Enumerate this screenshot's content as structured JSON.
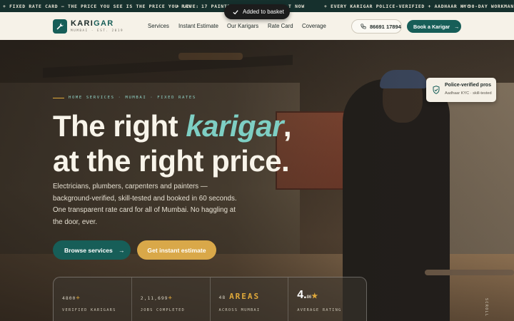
{
  "ticker": [
    "+ FIXED RATE CARD — THE PRICE YOU SEE IS THE PRICE YOU PAY",
    "+ LIVE:",
    "17 PAINTE",
    "T NOW",
    "+ EVERY KARIGAR POLICE-VERIFIED + AADHAAR KYC",
    "+ 90-DAY WORKMANS"
  ],
  "toast": {
    "text": "Added to basket",
    "icon": "check-icon"
  },
  "brand": {
    "name_a": "KARI",
    "name_b": "GAR",
    "tagline": "MUMBAI · EST. 2019",
    "icon": "wrench-icon"
  },
  "nav": {
    "items": [
      "Services",
      "Instant Estimate",
      "Our Karigars",
      "Rate Card",
      "Coverage"
    ],
    "phone": "86691 17894",
    "book": "Book a Karigar"
  },
  "hero": {
    "eyebrow": "HOME SERVICES · MUMBAI · FIXED RATES",
    "headline_a": "The right ",
    "headline_accent": "karigar",
    "headline_b": ",",
    "headline_c": "at the right price.",
    "paragraph": "Electricians, plumbers, carpenters and painters — background-verified, skill-tested and booked in 60 seconds. One transparent rate card for all of Mumbai. No haggling at the door, ever.",
    "cta_primary": "Browse services",
    "cta_secondary": "Get instant estimate"
  },
  "badge": {
    "title": "Police-verified pros",
    "subtitle": "Aadhaar KYC · skill-tested",
    "icon": "shield-check-icon"
  },
  "stats": [
    {
      "value": "4800",
      "suffix": "+",
      "label": "VERIFIED KARIGARS"
    },
    {
      "value": "2,11,699",
      "suffix": "+",
      "label": "JOBS COMPLETED"
    },
    {
      "value": "48",
      "suffix": "AREAS",
      "label": "ACROSS MUMBAI"
    },
    {
      "value": "4.",
      "suffix": "86",
      "label": "AVERAGE RATING"
    }
  ],
  "scroll_label": "SCROLL",
  "colors": {
    "brand": "#175e58",
    "accent": "#e0a93a",
    "cream": "#f6f2e8",
    "teal_text": "#7ecfc4"
  }
}
